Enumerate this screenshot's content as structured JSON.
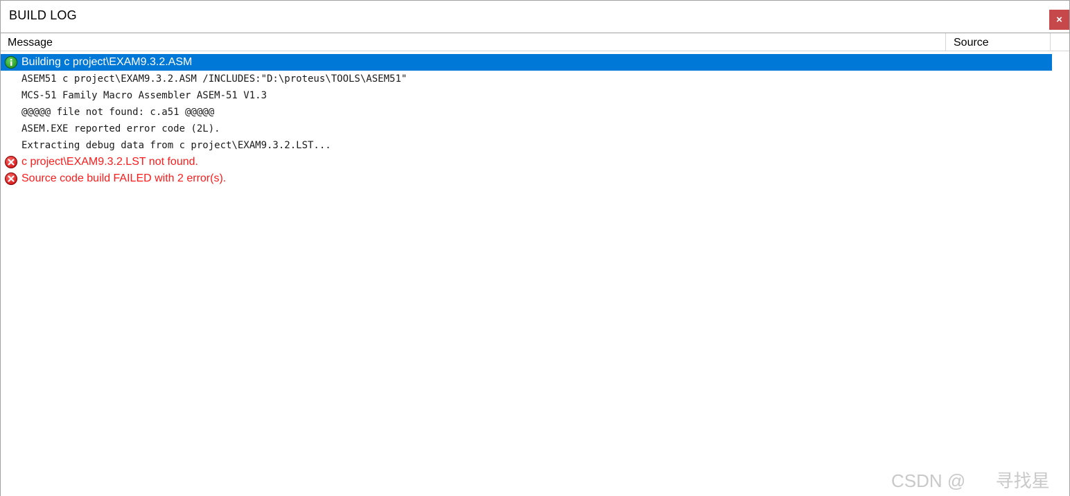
{
  "window": {
    "title": "BUILD LOG",
    "close_label": "×"
  },
  "columns": {
    "message": "Message",
    "source": "Source"
  },
  "rows": [
    {
      "icon": "info-icon",
      "text": "Building c project\\EXAM9.3.2.ASM",
      "type": "info",
      "selected": true
    },
    {
      "icon": "",
      "text": "ASEM51 c project\\EXAM9.3.2.ASM /INCLUDES:\"D:\\proteus\\TOOLS\\ASEM51\"",
      "type": "output"
    },
    {
      "icon": "",
      "text": "MCS-51 Family Macro Assembler ASEM-51 V1.3",
      "type": "output"
    },
    {
      "icon": "",
      "text": "@@@@@ file not found: c.a51 @@@@@",
      "type": "output"
    },
    {
      "icon": "",
      "text": "ASEM.EXE reported error code (2L).",
      "type": "output"
    },
    {
      "icon": "",
      "text": "Extracting debug data from c project\\EXAM9.3.2.LST...",
      "type": "output"
    },
    {
      "icon": "error-icon",
      "text": "c project\\EXAM9.3.2.LST not found.",
      "type": "error"
    },
    {
      "icon": "error-icon",
      "text": "Source code build FAILED with 2 error(s).",
      "type": "error"
    }
  ],
  "watermark": "CSDN @      寻找星",
  "colors": {
    "selection": "#0078d7",
    "error_text": "#ff1a1a",
    "close_button": "#c7484a"
  }
}
